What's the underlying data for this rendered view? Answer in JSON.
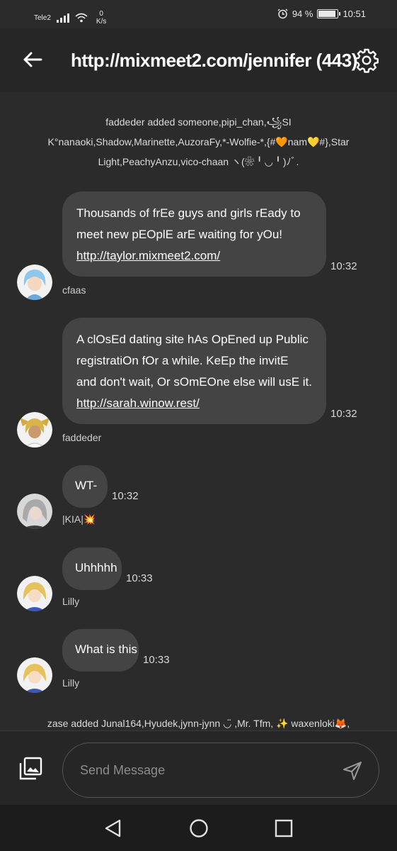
{
  "status_bar": {
    "carrier": "Tele2",
    "net_speed_value": "0",
    "net_speed_unit": "K/s",
    "battery": "94 %",
    "battery_level": 0.94,
    "time": "10:51"
  },
  "header": {
    "title": "http://mixmeet2.com/jennifer (443)",
    "back_icon": "arrow-left-icon",
    "settings_icon": "gear-icon"
  },
  "system_messages": {
    "added_1": "faddeder added someone,pipi_chan,꧁SI K°nanaoki,Shadow,Marinette,AuzoraFy,*-Wolfie-*,{#🧡nam💛#},Star Light,PeachyAnzu,vico-chaan ヽ(❀╹◡╹)ﾉﾞ.",
    "added_2": "zase added Junal164,Hyudek,jynn-jynn ◡̈ ,Mr. Tfm, ✨ waxenloki🦊,"
  },
  "messages": [
    {
      "lines": [
        "Thousands of frEe guys and girls rEady to",
        "meet new pEOplE arE waiting for yOu!"
      ],
      "link": "http://taylor.mixmeet2.com/",
      "time": "10:32",
      "sender": "cfaas"
    },
    {
      "lines": [
        "A clOsEd dating site hAs OpEned up Public",
        "registratiOn fOr a while. KeEp the invitE",
        "and don't wait, Or sOmEOne else will usE it."
      ],
      "link": "http://sarah.winow.rest/",
      "time": "10:32",
      "sender": "faddeder"
    },
    {
      "text": "WT-",
      "time": "10:32",
      "sender": "|KIA|💥"
    },
    {
      "text": "Uhhhhh",
      "time": "10:33",
      "sender": "Lilly"
    },
    {
      "text": "What is this",
      "time": "10:33",
      "sender": "Lilly"
    }
  ],
  "composer": {
    "placeholder": "Send Message",
    "gallery_icon": "gallery-icon",
    "send_icon": "send-icon"
  },
  "nav": {
    "back_icon": "triangle-back-icon",
    "home_icon": "circle-home-icon",
    "recents_icon": "square-recents-icon"
  },
  "colors": {
    "background": "#2b2b2b",
    "bubble": "#444444",
    "appbar": "#262626",
    "navbar": "#1c1c1c"
  }
}
